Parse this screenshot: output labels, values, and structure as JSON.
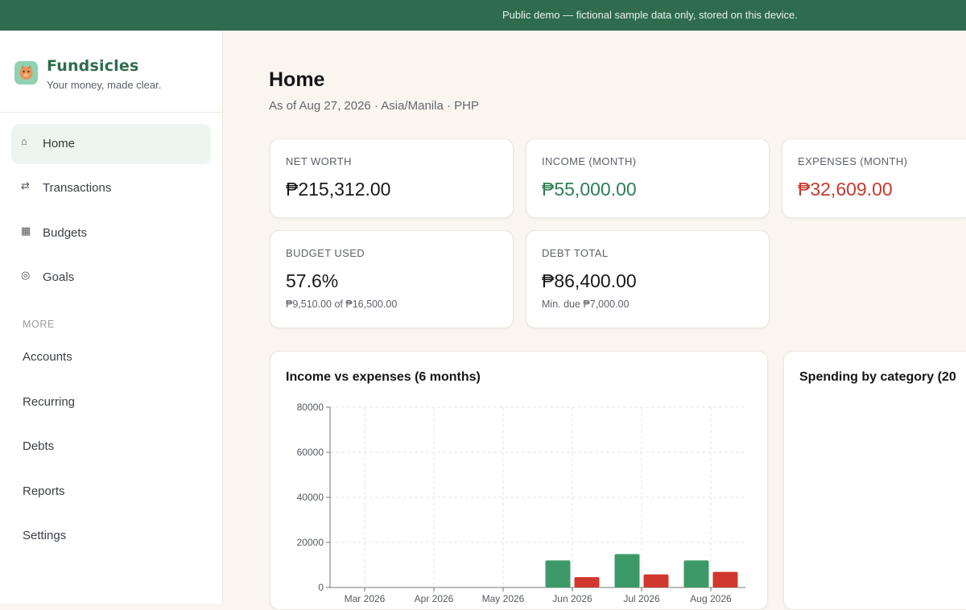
{
  "banner": {
    "text": "Public demo — fictional sample data only, stored on this device."
  },
  "brand": {
    "name": "Fundsicles",
    "tagline": "Your money, made clear."
  },
  "nav": {
    "items": [
      {
        "label": "Home",
        "icon": "home-icon",
        "glyph": "⌂",
        "active": true
      },
      {
        "label": "Transactions",
        "icon": "transfer-icon",
        "glyph": "⇄",
        "active": false
      },
      {
        "label": "Budgets",
        "icon": "grid-icon",
        "glyph": "▦",
        "active": false
      },
      {
        "label": "Goals",
        "icon": "target-icon",
        "glyph": "◎",
        "active": false
      }
    ],
    "more_label": "MORE",
    "more_items": [
      "Accounts",
      "Recurring",
      "Debts",
      "Reports",
      "Settings"
    ]
  },
  "header": {
    "title": "Home",
    "subtitle": "As of Aug 27, 2026 · Asia/Manila · PHP"
  },
  "cards": {
    "net_worth": {
      "label": "NET WORTH",
      "value": "₱215,312.00"
    },
    "income": {
      "label": "INCOME (MONTH)",
      "value": "₱55,000.00"
    },
    "expenses": {
      "label": "EXPENSES (MONTH)",
      "value": "₱32,609.00"
    },
    "budget": {
      "label": "BUDGET USED",
      "value": "57.6%",
      "sub": "₱9,510.00 of ₱16,500.00"
    },
    "debt": {
      "label": "DEBT TOTAL",
      "value": "₱86,400.00",
      "sub": "Min. due ₱7,000.00"
    }
  },
  "colors": {
    "accent": "#2f6b4d",
    "income": "#3d9a68",
    "expense": "#d0382f"
  },
  "chart_data": {
    "type": "bar",
    "title": "Income vs expenses (6 months)",
    "categories": [
      "Mar 2026",
      "Apr 2026",
      "May 2026",
      "Jun 2026",
      "Jul 2026",
      "Aug 2026"
    ],
    "series": [
      {
        "values": [
          0,
          0,
          0,
          12000,
          14800,
          12000
        ],
        "color": "#3d9a68"
      },
      {
        "values": [
          0,
          0,
          0,
          4600,
          5800,
          6900
        ],
        "color": "#d0382f"
      }
    ],
    "ylim": [
      0,
      80000
    ],
    "yticks": [
      0,
      20000,
      40000,
      60000,
      80000
    ],
    "grid": true
  },
  "spending_panel": {
    "title": "Spending by category (20"
  }
}
